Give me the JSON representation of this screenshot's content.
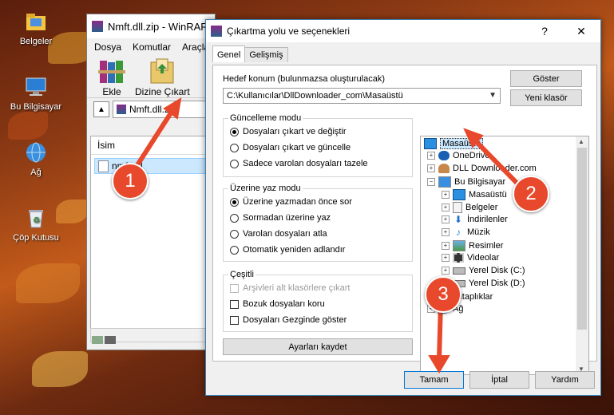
{
  "desktop": {
    "icons": [
      {
        "label": "Belgeler",
        "icon": "folder-icon"
      },
      {
        "label": "Bu Bilgisayar",
        "icon": "computer-icon"
      },
      {
        "label": "Ağ",
        "icon": "network-icon"
      },
      {
        "label": "Çöp Kutusu",
        "icon": "recycle-bin-icon"
      }
    ]
  },
  "winrar": {
    "title": "Nmft.dll.zip - WinRAR",
    "menu": [
      "Dosya",
      "Komutlar",
      "Araçlar"
    ],
    "tools": {
      "add": "Ekle",
      "extract": "Dizine Çıkart"
    },
    "address": "Nmft.dll.zip",
    "column_name": "İsim",
    "file": "nmft.dll"
  },
  "dialog": {
    "title": "Çıkartma yolu ve seçenekleri",
    "help": "?",
    "close": "✕",
    "tabs": [
      "Genel",
      "Gelişmiş"
    ],
    "dest_label": "Hedef konum (bulunmazsa oluşturulacak)",
    "dest_value": "C:\\Kullanıcılar\\DllDownloader_com\\Masaüstü",
    "show_button": "Göster",
    "new_folder_button": "Yeni klasör",
    "update_mode": {
      "title": "Güncelleme modu",
      "options": [
        "Dosyaları çıkart ve değiştir",
        "Dosyaları çıkart ve güncelle",
        "Sadece varolan dosyaları tazele"
      ],
      "selected": 0
    },
    "overwrite_mode": {
      "title": "Üzerine yaz modu",
      "options": [
        "Üzerine yazmadan önce sor",
        "Sormadan üzerine yaz",
        "Varolan dosyaları atla",
        "Otomatik yeniden adlandır"
      ],
      "selected": 0
    },
    "misc": {
      "title": "Çeşitli",
      "options": [
        {
          "label": "Arşivleri alt klasörlere çıkart",
          "disabled": true,
          "checked": false
        },
        {
          "label": "Bozuk dosyaları koru",
          "disabled": false,
          "checked": false
        },
        {
          "label": "Dosyaları Gezginde göster",
          "disabled": false,
          "checked": false
        }
      ]
    },
    "save_settings_button": "Ayarları kaydet",
    "tree": [
      {
        "label": "Masaüstü",
        "level": 0,
        "icon": "desktop-icon",
        "selected": true,
        "expander": ""
      },
      {
        "label": "OneDrive",
        "level": 1,
        "icon": "onedrive-icon",
        "expander": "+"
      },
      {
        "label": "DLL Downloader.com",
        "level": 1,
        "icon": "user-icon",
        "expander": "+"
      },
      {
        "label": "Bu Bilgisayar",
        "level": 1,
        "icon": "computer-icon",
        "expander": "−"
      },
      {
        "label": "Masaüstü",
        "level": 2,
        "icon": "desktop-icon",
        "expander": "+"
      },
      {
        "label": "Belgeler",
        "level": 2,
        "icon": "documents-icon",
        "expander": "+"
      },
      {
        "label": "İndirilenler",
        "level": 2,
        "icon": "downloads-icon",
        "expander": "+"
      },
      {
        "label": "Müzik",
        "level": 2,
        "icon": "music-icon",
        "expander": "+"
      },
      {
        "label": "Resimler",
        "level": 2,
        "icon": "pictures-icon",
        "expander": "+"
      },
      {
        "label": "Videolar",
        "level": 2,
        "icon": "videos-icon",
        "expander": "+"
      },
      {
        "label": "Yerel Disk (C:)",
        "level": 2,
        "icon": "drive-icon",
        "expander": "+"
      },
      {
        "label": "Yerel Disk (D:)",
        "level": 2,
        "icon": "drive-icon",
        "expander": "+"
      },
      {
        "label": "Kitaplıklar",
        "level": 1,
        "icon": "libraries-icon",
        "expander": "+"
      },
      {
        "label": "Ağ",
        "level": 1,
        "icon": "network-icon",
        "expander": "+"
      }
    ],
    "ok_button": "Tamam",
    "cancel_button": "İptal",
    "help_button": "Yardım"
  },
  "annotations": {
    "step1": "1",
    "step2": "2",
    "step3": "3"
  },
  "colors": {
    "accent": "#0078d7",
    "badge": "#e8482b",
    "selection": "#cce8ff"
  }
}
